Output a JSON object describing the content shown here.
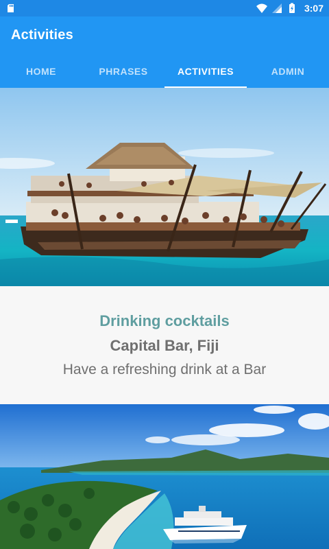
{
  "status_bar": {
    "time": "3:07",
    "icons": [
      "sd-card-icon",
      "wifi-icon",
      "signal-icon",
      "battery-charging-icon"
    ]
  },
  "app_bar": {
    "title": "Activities"
  },
  "tabs": [
    {
      "label": "HOME",
      "active": false
    },
    {
      "label": "PHRASES",
      "active": false
    },
    {
      "label": "ACTIVITIES",
      "active": true
    },
    {
      "label": "ADMIN",
      "active": false
    }
  ],
  "activities": [
    {
      "title": "Drinking cocktails",
      "subtitle": "Capital Bar, Fiji",
      "description": "Have a refreshing drink at a Bar"
    }
  ],
  "colors": {
    "status_bar": "#1e88e5",
    "app_bar": "#2196f3",
    "card_title": "#5f9ea0",
    "card_text": "#6f6f6f"
  }
}
